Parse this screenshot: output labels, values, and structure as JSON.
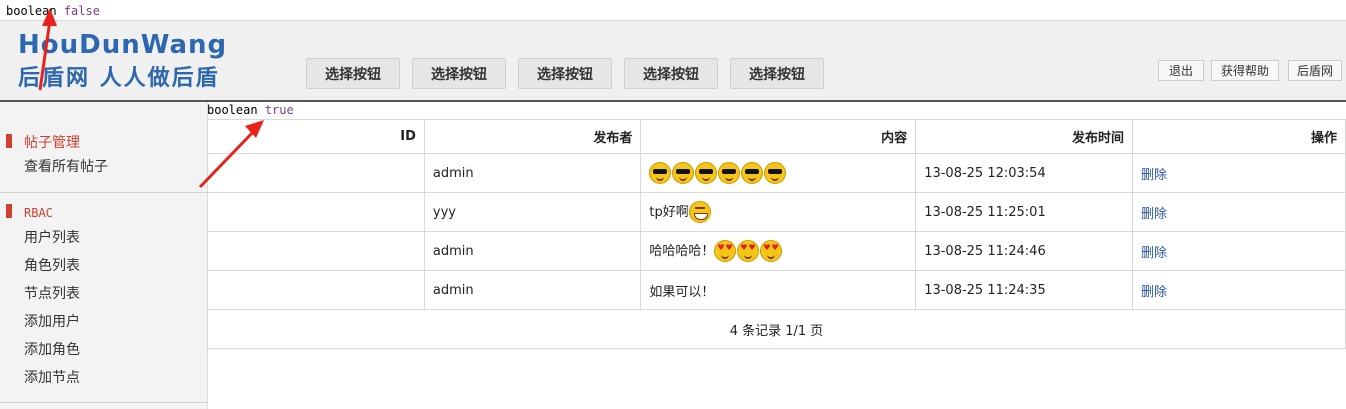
{
  "debug": {
    "top": {
      "keyword": "boolean",
      "value": "false"
    },
    "mid": {
      "keyword": "boolean",
      "value": "true"
    }
  },
  "logo": {
    "word": "HouDunWang",
    "slogan": "后盾网 人人做后盾"
  },
  "toolbar": {
    "select_buttons": [
      "选择按钮",
      "选择按钮",
      "选择按钮",
      "选择按钮",
      "选择按钮"
    ],
    "logout": "退出",
    "help": "获得帮助",
    "home": "后盾网"
  },
  "sidebar": {
    "groups": [
      {
        "title": "帖子管理",
        "items": [
          "查看所有帖子"
        ]
      },
      {
        "title": "RBAC",
        "items": [
          "用户列表",
          "角色列表",
          "节点列表",
          "添加用户",
          "添加角色",
          "添加节点"
        ]
      }
    ]
  },
  "table": {
    "headers": [
      "ID",
      "发布者",
      "内容",
      "发布时间",
      "操作"
    ],
    "rows": [
      {
        "id": "",
        "author": "admin",
        "content_text": "",
        "emoji": "cool x6",
        "time": "13-08-25 12:03:54",
        "action": "删除"
      },
      {
        "id": "",
        "author": "yyy",
        "content_text": "tp好啊",
        "emoji": "grin x1",
        "time": "13-08-25 11:25:01",
        "action": "删除"
      },
      {
        "id": "",
        "author": "admin",
        "content_text": "哈哈哈哈！",
        "emoji": "heart-eyes x3",
        "time": "13-08-25 11:24:46",
        "action": "删除"
      },
      {
        "id": "",
        "author": "admin",
        "content_text": "如果可以！",
        "emoji": "",
        "time": "13-08-25 11:24:35",
        "action": "删除"
      }
    ],
    "pager": "4 条记录 1/1 页"
  },
  "colors": {
    "accent_red": "#d0402f",
    "link_blue": "#2956a8",
    "logo_blue": "#2c67b0",
    "arrow_red": "#e8231c"
  }
}
